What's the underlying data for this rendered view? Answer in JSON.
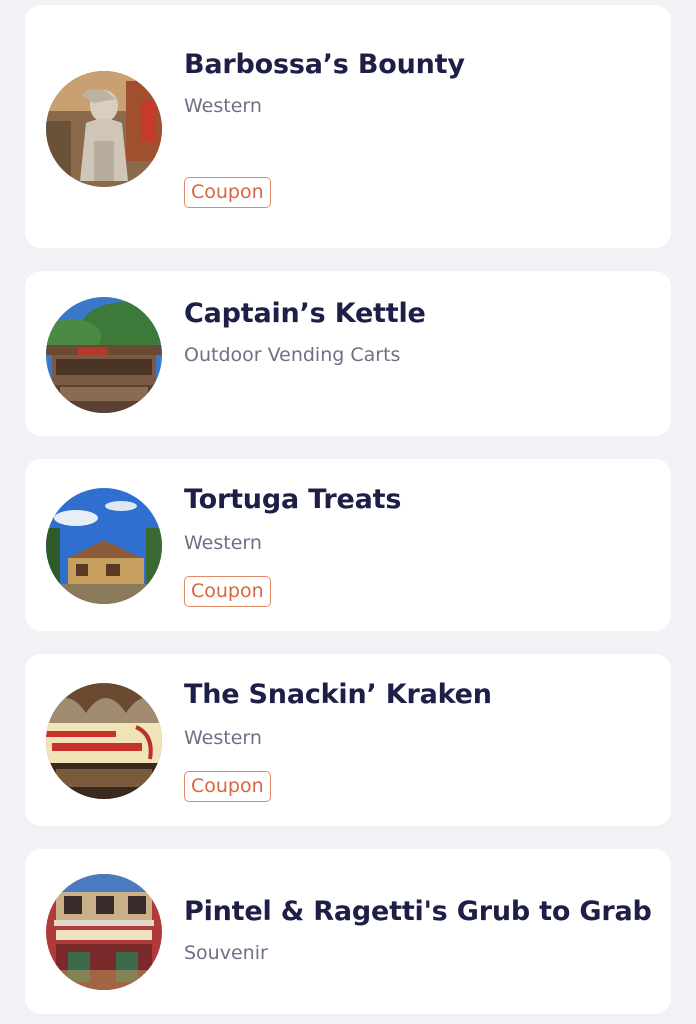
{
  "restaurants": [
    {
      "name": "Barbossa’s Bounty",
      "category": "Western",
      "badge": "Coupon",
      "image_icon": "barbossa-statue-photo-icon"
    },
    {
      "name": "Captain’s Kettle",
      "category": "Outdoor Vending Carts",
      "image_icon": "vending-cart-photo-icon"
    },
    {
      "name": "Tortuga Treats",
      "category": "Western",
      "badge": "Coupon",
      "image_icon": "tortuga-building-photo-icon"
    },
    {
      "name": "The Snackin’ Kraken",
      "category": "Western",
      "badge": "Coupon",
      "image_icon": "kraken-stall-photo-icon"
    },
    {
      "name": "Pintel & Ragetti's Grub to Grab",
      "category": "Souvenir",
      "image_icon": "pintel-ragetti-storefront-photo-icon"
    }
  ],
  "colors": {
    "background": "#f2f2f6",
    "card": "#ffffff",
    "title": "#1d1f47",
    "subtitle": "#6e7184",
    "coupon": "#d9663f"
  }
}
